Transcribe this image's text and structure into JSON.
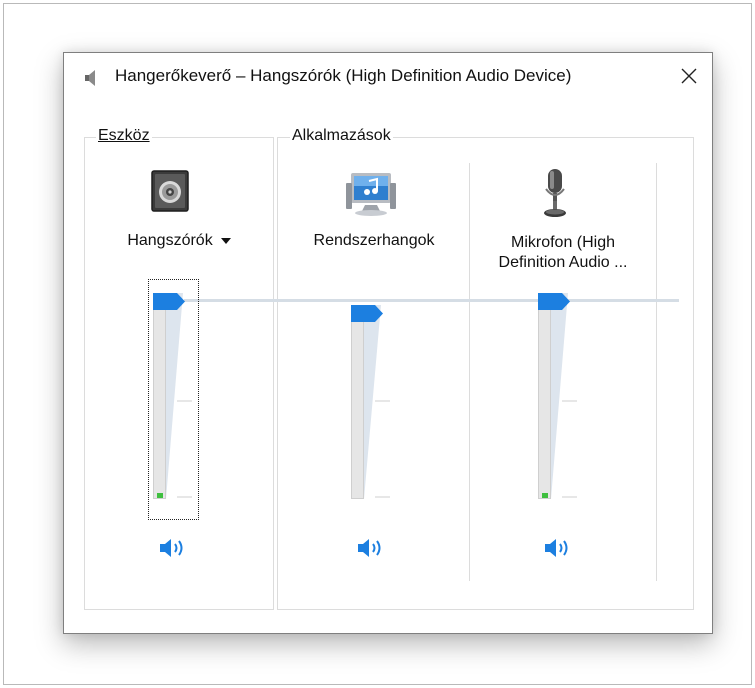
{
  "window": {
    "title": "Hangerőkeverő – Hangszórók (High Definition Audio Device)",
    "close_icon": "close-icon"
  },
  "device_group": {
    "label": "Eszköz",
    "label_mnemonic": "E",
    "device_name": "Hangszórók",
    "icon": "speaker-icon",
    "volume": 1.0
  },
  "apps_group": {
    "label": "Alkalmazások",
    "apps": [
      {
        "name": "Rendszerhangok",
        "icon": "system-sounds-icon",
        "volume": 1.0
      },
      {
        "name_line1": "Mikrofon (High",
        "name_line2": "Definition Audio ...",
        "icon": "microphone-icon",
        "volume": 1.0
      }
    ]
  },
  "colors": {
    "accent": "#1c7fe0",
    "meter_green": "#3fbf3f",
    "track": "#e6e6e6"
  },
  "icons": {
    "mute_toggle": "speaker-volume-icon"
  }
}
